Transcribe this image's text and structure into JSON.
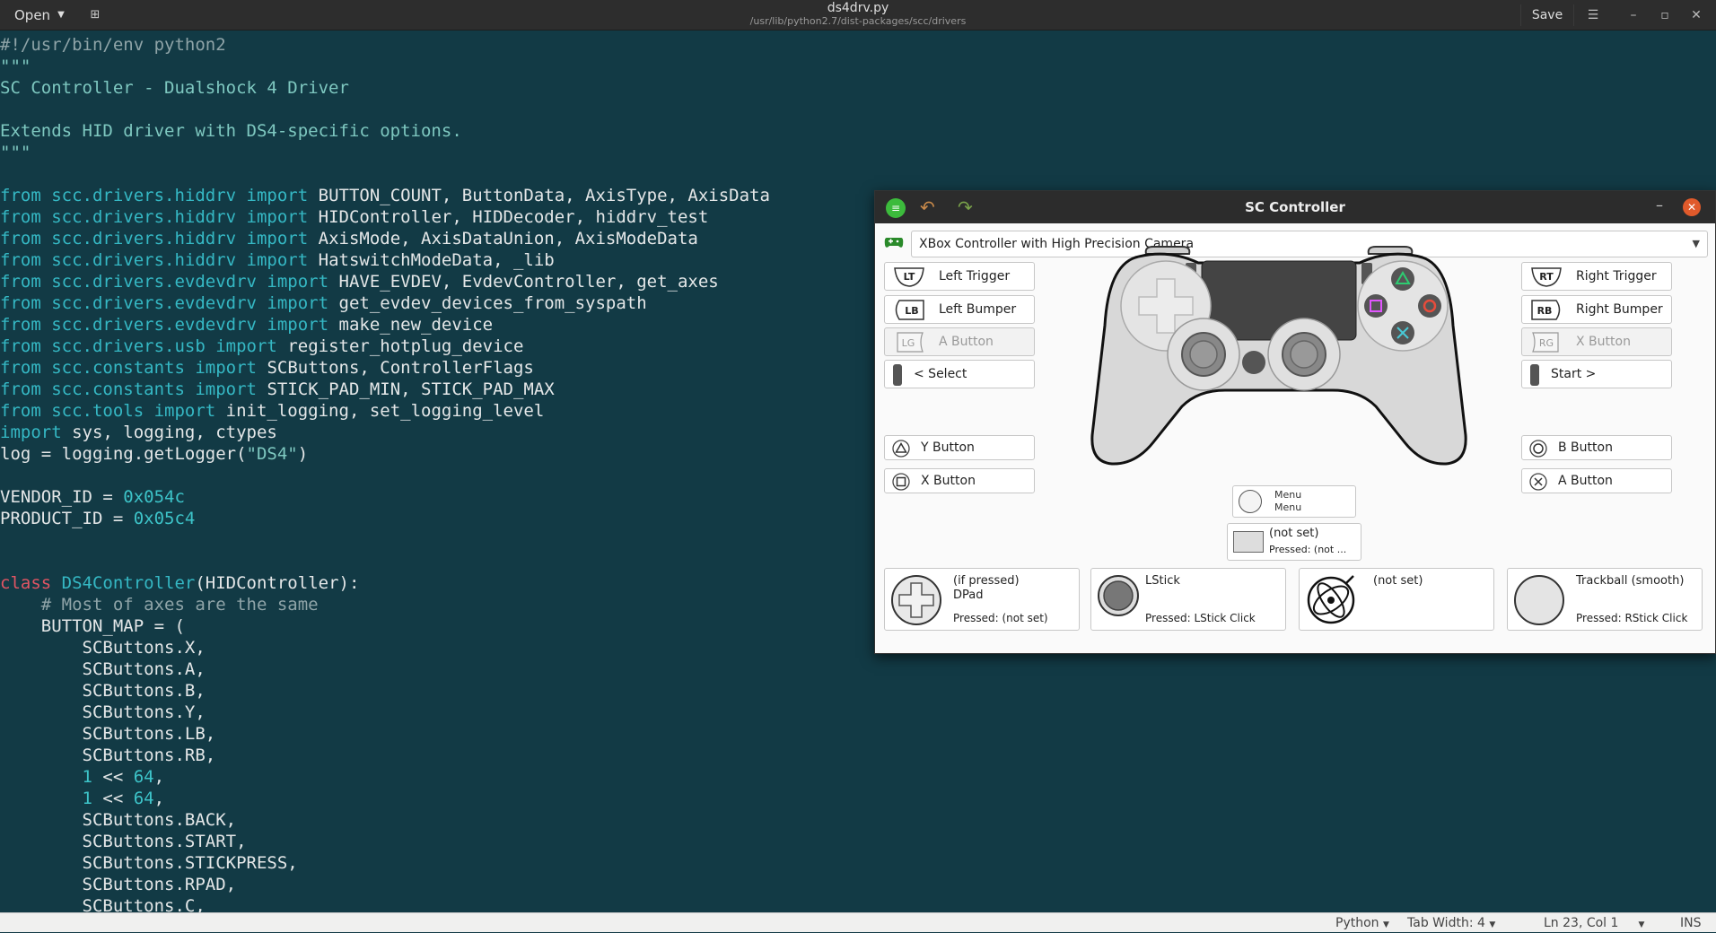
{
  "topbar": {
    "open_label": "Open",
    "title": "ds4drv.py",
    "subtitle": "/usr/lib/python2.7/dist-packages/scc/drivers",
    "save_label": "Save"
  },
  "status": {
    "language": "Python",
    "tab_width": "Tab Width: 4",
    "position": "Ln 23, Col 1",
    "mode": "INS"
  },
  "code_lines": [
    [
      [
        "cm",
        "#!/usr/bin/env python2"
      ]
    ],
    [
      [
        "str",
        "\"\"\""
      ]
    ],
    [
      [
        "str",
        "SC Controller - Dualshock 4 Driver"
      ]
    ],
    [],
    [
      [
        "str",
        "Extends HID driver with DS4-specific options."
      ]
    ],
    [
      [
        "str",
        "\"\"\""
      ]
    ],
    [],
    [
      [
        "kw",
        "from "
      ],
      [
        "fn",
        "scc.drivers.hiddrv"
      ],
      [
        "kw",
        " import "
      ],
      [
        "",
        "BUTTON_COUNT, ButtonData, AxisType, AxisData"
      ]
    ],
    [
      [
        "kw",
        "from "
      ],
      [
        "fn",
        "scc.drivers.hiddrv"
      ],
      [
        "kw",
        " import "
      ],
      [
        "",
        "HIDController, HIDDecoder, hiddrv_test"
      ]
    ],
    [
      [
        "kw",
        "from "
      ],
      [
        "fn",
        "scc.drivers.hiddrv"
      ],
      [
        "kw",
        " import "
      ],
      [
        "",
        "AxisMode, AxisDataUnion, AxisModeData"
      ]
    ],
    [
      [
        "kw",
        "from "
      ],
      [
        "fn",
        "scc.drivers.hiddrv"
      ],
      [
        "kw",
        " import "
      ],
      [
        "",
        "HatswitchModeData, _lib"
      ]
    ],
    [
      [
        "kw",
        "from "
      ],
      [
        "fn",
        "scc.drivers.evdevdrv"
      ],
      [
        "kw",
        " import "
      ],
      [
        "",
        "HAVE_EVDEV, EvdevController, get_axes"
      ]
    ],
    [
      [
        "kw",
        "from "
      ],
      [
        "fn",
        "scc.drivers.evdevdrv"
      ],
      [
        "kw",
        " import "
      ],
      [
        "",
        "get_evdev_devices_from_syspath"
      ]
    ],
    [
      [
        "kw",
        "from "
      ],
      [
        "fn",
        "scc.drivers.evdevdrv"
      ],
      [
        "kw",
        " import "
      ],
      [
        "",
        "make_new_device"
      ]
    ],
    [
      [
        "kw",
        "from "
      ],
      [
        "fn",
        "scc.drivers.usb"
      ],
      [
        "kw",
        " import "
      ],
      [
        "",
        "register_hotplug_device"
      ]
    ],
    [
      [
        "kw",
        "from "
      ],
      [
        "fn",
        "scc.constants"
      ],
      [
        "kw",
        " import "
      ],
      [
        "",
        "SCButtons, ControllerFlags"
      ]
    ],
    [
      [
        "kw",
        "from "
      ],
      [
        "fn",
        "scc.constants"
      ],
      [
        "kw",
        " import "
      ],
      [
        "",
        "STICK_PAD_MIN, STICK_PAD_MAX"
      ]
    ],
    [
      [
        "kw",
        "from "
      ],
      [
        "fn",
        "scc.tools"
      ],
      [
        "kw",
        " import "
      ],
      [
        "",
        "init_logging, set_logging_level"
      ]
    ],
    [
      [
        "kw",
        "import "
      ],
      [
        "",
        "sys, logging, ctypes"
      ]
    ],
    [
      [
        "",
        "log = logging.getLogger("
      ],
      [
        "str",
        "\"DS4\""
      ],
      [
        "",
        ")"
      ]
    ],
    [],
    [
      [
        "",
        "VENDOR_ID = "
      ],
      [
        "num",
        "0x054c"
      ]
    ],
    [
      [
        "",
        "PRODUCT_ID = "
      ],
      [
        "num",
        "0x05c4"
      ]
    ],
    [],
    [],
    [
      [
        "cls",
        "class "
      ],
      [
        "fn",
        "DS4Controller"
      ],
      [
        "",
        "(HIDController):"
      ]
    ],
    [
      [
        "cm",
        "    # Most of axes are the same"
      ]
    ],
    [
      [
        "",
        "    BUTTON_MAP = ("
      ]
    ],
    [
      [
        "",
        "        SCButtons.X,"
      ]
    ],
    [
      [
        "",
        "        SCButtons.A,"
      ]
    ],
    [
      [
        "",
        "        SCButtons.B,"
      ]
    ],
    [
      [
        "",
        "        SCButtons.Y,"
      ]
    ],
    [
      [
        "",
        "        SCButtons.LB,"
      ]
    ],
    [
      [
        "",
        "        SCButtons.RB,"
      ]
    ],
    [
      [
        "",
        "        "
      ],
      [
        "num",
        "1"
      ],
      [
        "",
        " << "
      ],
      [
        "num",
        "64"
      ],
      [
        "",
        ","
      ]
    ],
    [
      [
        "",
        "        "
      ],
      [
        "num",
        "1"
      ],
      [
        "",
        " << "
      ],
      [
        "num",
        "64"
      ],
      [
        "",
        ","
      ]
    ],
    [
      [
        "",
        "        SCButtons.BACK,"
      ]
    ],
    [
      [
        "",
        "        SCButtons.START,"
      ]
    ],
    [
      [
        "",
        "        SCButtons.STICKPRESS,"
      ]
    ],
    [
      [
        "",
        "        SCButtons.RPAD,"
      ]
    ],
    [
      [
        "",
        "        SCButtons.C,"
      ]
    ]
  ],
  "sc": {
    "title": "SC Controller",
    "profile": "XBox Controller with High Precision Camera",
    "left": {
      "lt_icon": "LT",
      "lt": "Left Trigger",
      "lb_icon": "LB",
      "lb": "Left Bumper",
      "lg_icon": "LG",
      "lg": "A Button",
      "select": "< Select",
      "y": "Y Button",
      "x": "X Button"
    },
    "right": {
      "rt_icon": "RT",
      "rt": "Right Trigger",
      "rb_icon": "RB",
      "rb": "Right Bumper",
      "rg_icon": "RG",
      "rg": "X Button",
      "start": "Start >",
      "b": "B Button",
      "a": "A Button"
    },
    "menu": {
      "line1": "Menu",
      "line2": "Menu"
    },
    "center_notset": {
      "line1": "(not set)",
      "line2": "Pressed: (not ..."
    },
    "pads": {
      "dpad": {
        "t1": "(if pressed)",
        "t2": "DPad",
        "t3": "Pressed: (not set)"
      },
      "lstick": {
        "t1": "LStick",
        "t3": "Pressed: LStick Click"
      },
      "gyro": {
        "t1": "(not set)"
      },
      "trackball": {
        "t1": "Trackball (smooth)",
        "t3": "Pressed: RStick Click"
      }
    }
  }
}
